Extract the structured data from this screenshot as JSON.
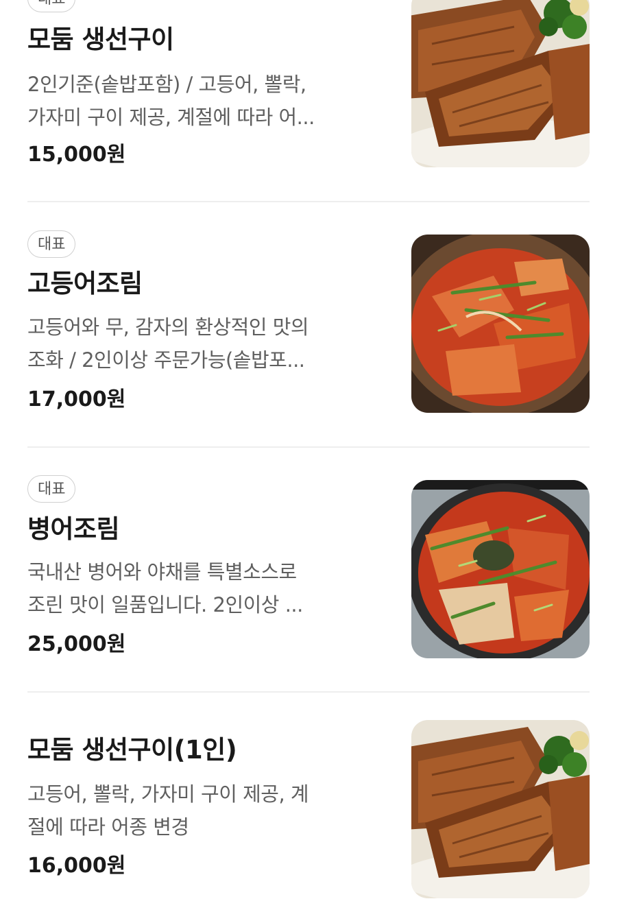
{
  "menu": {
    "items": [
      {
        "badge": "대표",
        "name": "모둠 생선구이",
        "desc_lines": [
          "2인기준(솥밥포함) / 고등어, 뽈락,",
          "가자미 구이 제공, 계절에 따라 어..."
        ],
        "price": "15,000원",
        "photo_icon": "grilled-fish-photo"
      },
      {
        "badge": "대표",
        "name": "고등어조림",
        "desc_lines": [
          "고등어와 무, 감자의 환상적인 맛의",
          "조화 / 2인이상 주문가능(솥밥포..."
        ],
        "price": "17,000원",
        "photo_icon": "braised-mackerel-photo"
      },
      {
        "badge": "대표",
        "name": "병어조림",
        "desc_lines": [
          "국내산 병어와 야채를 특별소스로",
          "조린 맛이 일품입니다. 2인이상 ..."
        ],
        "price": "25,000원",
        "photo_icon": "braised-butterfish-photo"
      },
      {
        "name": "모둠 생선구이(1인)",
        "desc_lines": [
          "고등어, 뽈락, 가자미 구이 제공, 계",
          "절에 따라 어종 변경"
        ],
        "price": "16,000원",
        "photo_icon": "grilled-fish-photo"
      }
    ]
  },
  "colors": {
    "text_primary": "#1a1a1a",
    "text_secondary": "#5f5f5f",
    "badge_border": "#cfcfcf",
    "divider": "#eeeeee"
  }
}
